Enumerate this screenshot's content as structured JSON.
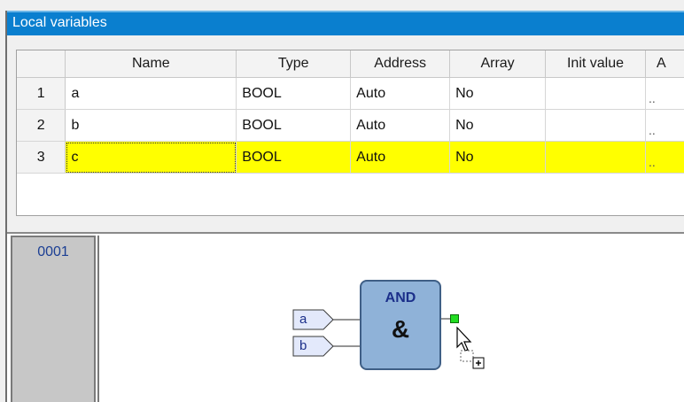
{
  "panel": {
    "title": "Local variables"
  },
  "table": {
    "headers": [
      "",
      "Name",
      "Type",
      "Address",
      "Array",
      "Init value",
      "A"
    ],
    "rows": [
      {
        "num": "1",
        "name": "a",
        "type": "BOOL",
        "address": "Auto",
        "array": "No",
        "init": "",
        "more": ".."
      },
      {
        "num": "2",
        "name": "b",
        "type": "BOOL",
        "address": "Auto",
        "array": "No",
        "init": "",
        "more": ".."
      },
      {
        "num": "3",
        "name": "c",
        "type": "BOOL",
        "address": "Auto",
        "array": "No",
        "init": "",
        "more": ".."
      }
    ],
    "selected_row_color": "#ffff00"
  },
  "editor": {
    "network_number": "0001",
    "block": {
      "title": "AND",
      "symbol": "&",
      "inputs": [
        "a",
        "b"
      ],
      "fill_color": "#8fb2d8",
      "output_pin_color": "#22dd22"
    },
    "cursor_icon": "drag-add-cursor-icon"
  }
}
